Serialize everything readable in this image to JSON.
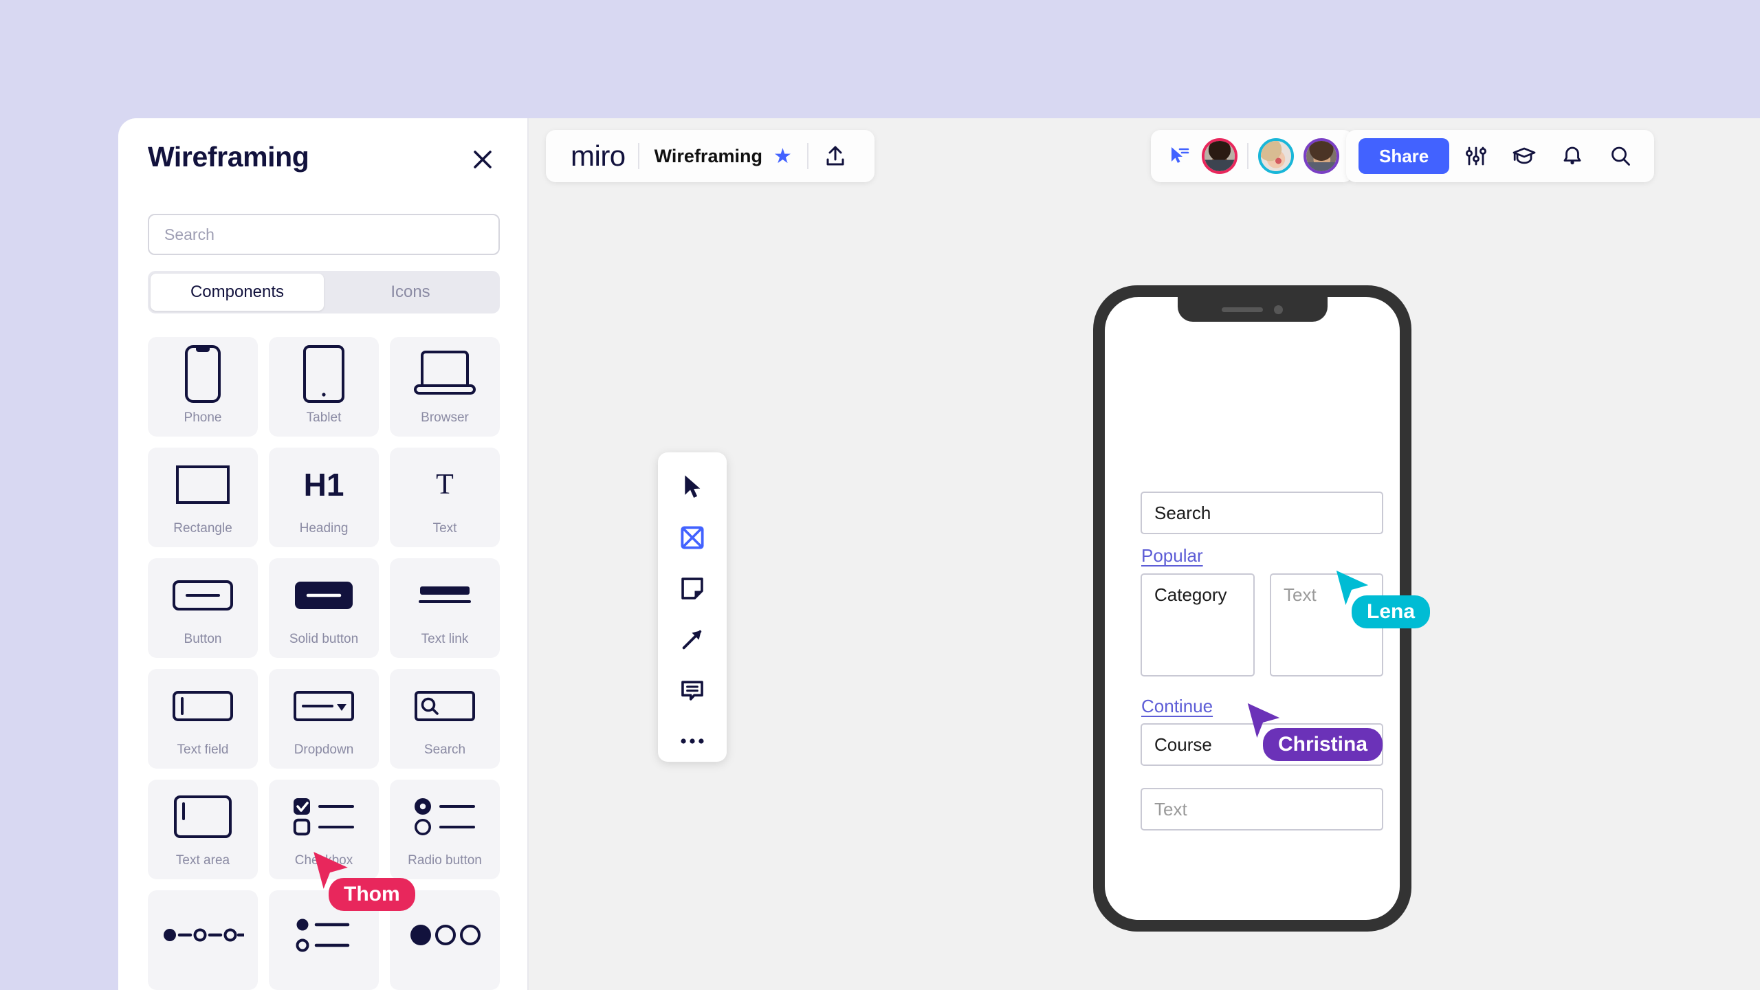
{
  "background_color": "#d8d8f2",
  "panel": {
    "title": "Wireframing",
    "close_icon": "close-icon",
    "search": {
      "value": "",
      "placeholder": "Search"
    },
    "tabs": [
      {
        "label": "Components",
        "active": true
      },
      {
        "label": "Icons",
        "active": false
      }
    ],
    "components": [
      {
        "label": "Phone",
        "icon": "phone-icon"
      },
      {
        "label": "Tablet",
        "icon": "tablet-icon"
      },
      {
        "label": "Browser",
        "icon": "browser-icon"
      },
      {
        "label": "Rectangle",
        "icon": "rectangle-icon"
      },
      {
        "label": "Heading",
        "icon": "heading-h1-icon"
      },
      {
        "label": "Text",
        "icon": "text-t-icon"
      },
      {
        "label": "Button",
        "icon": "button-icon"
      },
      {
        "label": "Solid button",
        "icon": "solid-button-icon"
      },
      {
        "label": "Text link",
        "icon": "text-link-icon"
      },
      {
        "label": "Text field",
        "icon": "text-field-icon"
      },
      {
        "label": "Dropdown",
        "icon": "dropdown-icon"
      },
      {
        "label": "Search",
        "icon": "search-component-icon"
      },
      {
        "label": "Text area",
        "icon": "text-area-icon"
      },
      {
        "label": "Checkbox",
        "icon": "checkbox-icon"
      },
      {
        "label": "Radio button",
        "icon": "radio-button-icon"
      },
      {
        "label": "",
        "icon": "stepper-icon"
      },
      {
        "label": "",
        "icon": "bullet-list-icon"
      },
      {
        "label": "",
        "icon": "carousel-dots-icon"
      }
    ],
    "heading_glyph": "H1",
    "text_glyph": "T"
  },
  "header": {
    "logo": "miro",
    "board_name": "Wireframing",
    "star_icon": "star-icon",
    "star_glyph": "★",
    "upload_icon": "upload-icon",
    "cursor_icon": "cursor-select-icon",
    "share_label": "Share",
    "icons": [
      {
        "name": "sliders-icon"
      },
      {
        "name": "graduation-cap-icon"
      },
      {
        "name": "bell-icon"
      },
      {
        "name": "search-icon"
      }
    ],
    "avatars": [
      {
        "name": "avatar-1",
        "ring_color": "#e8275c",
        "skin": "#8a5a3b",
        "hair": "#2a1a12",
        "bg": "#b9b0a5"
      },
      {
        "name": "avatar-2",
        "ring_color": "#19b6d8",
        "skin": "#f0c9ae",
        "hair": "#d8bc92",
        "bg": "#e9e1dc"
      },
      {
        "name": "avatar-3",
        "ring_color": "#7a3fc4",
        "skin": "#d6a882",
        "hair": "#4b3425",
        "bg": "#7e7268"
      }
    ],
    "accent_color": "#4262ff"
  },
  "toolbar": {
    "tools": [
      {
        "name": "cursor-tool",
        "active": false
      },
      {
        "name": "wireframe-tool",
        "active": true
      },
      {
        "name": "sticky-note-tool",
        "active": false
      },
      {
        "name": "arrow-tool",
        "active": false
      },
      {
        "name": "comment-tool",
        "active": false
      },
      {
        "name": "more-tools",
        "active": false
      }
    ],
    "active_color": "#4262ff"
  },
  "canvas": {
    "phone_mockup": {
      "fields": [
        {
          "id": "search",
          "text": "Search",
          "placeholder": false
        },
        {
          "id": "category",
          "text": "Category",
          "placeholder": false
        },
        {
          "id": "text1",
          "text": "Text",
          "placeholder": true
        },
        {
          "id": "course",
          "text": "Course",
          "placeholder": false
        },
        {
          "id": "text2",
          "text": "Text",
          "placeholder": true
        }
      ],
      "links": [
        {
          "id": "popular",
          "text": "Popular"
        },
        {
          "id": "continue",
          "text": "Continue"
        }
      ],
      "link_color": "#5d5dd6"
    },
    "collaborators": [
      {
        "name": "Lena",
        "color": "#00bcd4"
      },
      {
        "name": "Christina",
        "color": "#6b32b8"
      },
      {
        "name": "Thom",
        "color": "#e8275c"
      }
    ]
  }
}
